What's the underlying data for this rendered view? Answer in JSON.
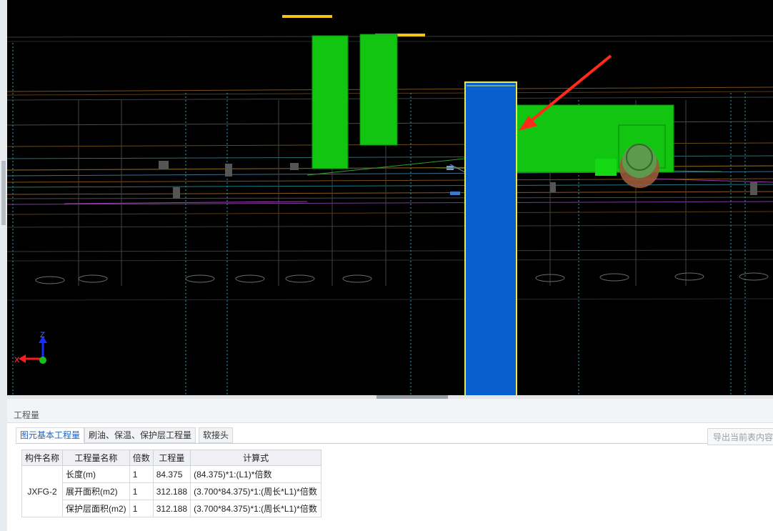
{
  "panel": {
    "title": "工程量",
    "tabs": [
      "图元基本工程量",
      "刷油、保温、保护层工程量",
      "软接头"
    ],
    "active_tab": "图元基本工程量",
    "export_button": "导出当前表内容"
  },
  "table": {
    "columns": [
      "构件名称",
      "工程量名称",
      "倍数",
      "工程量",
      "计算式"
    ],
    "component": "JXFG-2",
    "rows": [
      {
        "name": "长度(m)",
        "multiple": "1",
        "quantity": "84.375",
        "formula": "(84.375)*1:(L1)*倍数"
      },
      {
        "name": "展开面积(m2)",
        "multiple": "1",
        "quantity": "312.188",
        "formula": "(3.700*84.375)*1:(周长*L1)*倍数"
      },
      {
        "name": "保护层面积(m2)",
        "multiple": "1",
        "quantity": "312.188",
        "formula": "(3.700*84.375)*1:(周长*L1)*倍数"
      }
    ]
  },
  "viewport": {
    "axis_labels": {
      "z": "Z",
      "x": "X"
    },
    "colors": {
      "background": "#000000",
      "green_duct": "#11c511",
      "blue_pipe": "#0a5fcf",
      "arrow": "#ff2a1a",
      "grid_orange": "#8a5a1e",
      "grid_cyan": "#2aa7b3"
    }
  }
}
